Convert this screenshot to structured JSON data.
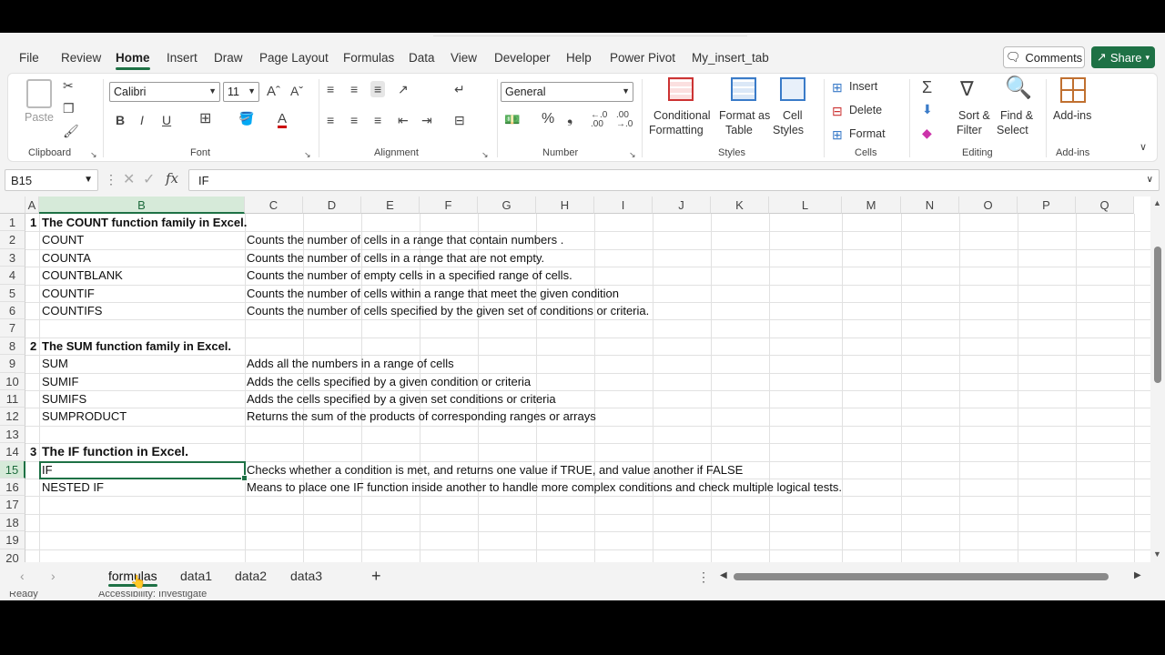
{
  "menu": {
    "tabs": [
      "File",
      "Review",
      "Home",
      "Insert",
      "Draw",
      "Page Layout",
      "Formulas",
      "Data",
      "View",
      "Developer",
      "Help",
      "Power Pivot",
      "My_insert_tab"
    ],
    "active": "Home",
    "comments_label": "Comments",
    "share_label": "Share"
  },
  "ribbon": {
    "clipboard": {
      "label": "Clipboard",
      "paste": "Paste"
    },
    "font": {
      "label": "Font",
      "family": "Calibri",
      "size": "11"
    },
    "alignment": {
      "label": "Alignment"
    },
    "number": {
      "label": "Number",
      "format": "General"
    },
    "styles": {
      "label": "Styles",
      "conditional": "Conditional",
      "conditional2": "Formatting",
      "format_as": "Format as",
      "table": "Table",
      "cell": "Cell",
      "styles": "Styles"
    },
    "cells": {
      "label": "Cells",
      "insert": "Insert",
      "delete": "Delete",
      "format": "Format"
    },
    "editing": {
      "label": "Editing",
      "sort": "Sort &",
      "filter": "Filter",
      "find": "Find &",
      "select": "Select"
    },
    "addins": {
      "label": "Add-ins",
      "addins": "Add-ins"
    }
  },
  "formula_bar": {
    "name_box": "B15",
    "formula": "IF",
    "fx": "fx"
  },
  "grid": {
    "columns": [
      "A",
      "B",
      "C",
      "D",
      "E",
      "F",
      "G",
      "H",
      "I",
      "J",
      "K",
      "L",
      "M",
      "N",
      "O",
      "P",
      "Q"
    ],
    "rows": [
      "1",
      "2",
      "3",
      "4",
      "5",
      "6",
      "7",
      "8",
      "9",
      "10",
      "11",
      "12",
      "13",
      "14",
      "15",
      "16",
      "17",
      "18",
      "19",
      "20"
    ],
    "cells": {
      "r1a": "1",
      "r1b": "The COUNT function family in Excel.",
      "r2b": "COUNT",
      "r2c": "Counts the number of cells in a range that contain numbers .",
      "r3b": "COUNTA",
      "r3c": "Counts the number of cells in a range that are not empty.",
      "r4b": "COUNTBLANK",
      "r4c": "Counts the number of empty cells in a specified range of cells.",
      "r5b": "COUNTIF",
      "r5c": "Counts the number of  cells within  a range that meet the given condition",
      "r6b": "COUNTIFS",
      "r6c": "Counts the number of cells specified by the given set of conditions or criteria.",
      "r8a": "2",
      "r8b": "The SUM function family in Excel.",
      "r9b": "SUM",
      "r9c": "Adds all the numbers in a range of cells",
      "r10b": "SUMIF",
      "r10c": "Adds the cells specified by a given condition or criteria",
      "r11b": "SUMIFS",
      "r11c": "Adds the cells specified by a given set conditions or criteria",
      "r12b": "SUMPRODUCT",
      "r12c": "Returns the sum of the products of corresponding ranges or arrays",
      "r14a": "3",
      "r14b": "The IF function in Excel.",
      "r15b": "IF",
      "r15c": "Checks whether a  condition is met, and returns one value if TRUE, and value another if FALSE",
      "r16b": "NESTED IF",
      "r16c": "Means to place one IF function inside another to handle more complex conditions and check multiple logical tests."
    }
  },
  "sheets": {
    "tabs": [
      "formulas",
      "data1",
      "data2",
      "data3"
    ],
    "active": "formulas",
    "add": "+"
  },
  "status": {
    "ready": "Ready",
    "accessibility": "Accessibility: Investigate"
  },
  "colors": {
    "accent": "#1e7145"
  }
}
